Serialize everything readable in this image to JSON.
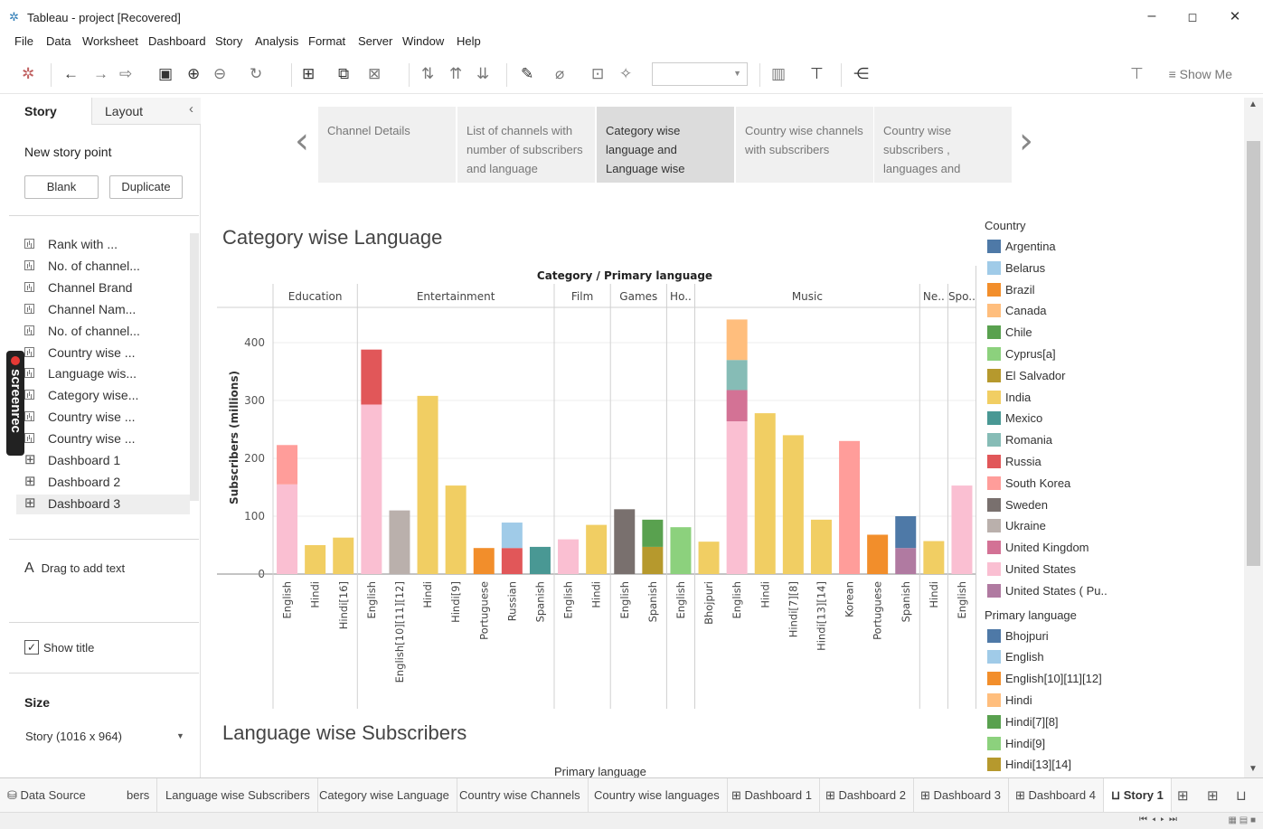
{
  "window": {
    "title": "Tableau - project [Recovered]",
    "minimize": "–",
    "restore": "◻",
    "close": "✕"
  },
  "menu": [
    "File",
    "Data",
    "Worksheet",
    "Dashboard",
    "Story",
    "Analysis",
    "Format",
    "Server",
    "Window",
    "Help"
  ],
  "toolbar": {
    "show_me_label": "Show Me"
  },
  "left_pane": {
    "tab_story": "Story",
    "tab_layout": "Layout",
    "collapse": "‹",
    "new_story_point": "New story point",
    "blank_button": "Blank",
    "duplicate_button": "Duplicate",
    "sheets": [
      {
        "label": "Rank with ...",
        "kind": "worksheet"
      },
      {
        "label": "No. of channel...",
        "kind": "worksheet"
      },
      {
        "label": "Channel Brand",
        "kind": "worksheet"
      },
      {
        "label": "Channel Nam...",
        "kind": "worksheet"
      },
      {
        "label": "No. of channel...",
        "kind": "worksheet"
      },
      {
        "label": "Country wise ...",
        "kind": "worksheet"
      },
      {
        "label": "Language wis...",
        "kind": "worksheet"
      },
      {
        "label": "Category wise...",
        "kind": "worksheet"
      },
      {
        "label": "Country  wise ...",
        "kind": "worksheet"
      },
      {
        "label": "Country wise ...",
        "kind": "worksheet"
      },
      {
        "label": "Dashboard 1",
        "kind": "dashboard"
      },
      {
        "label": "Dashboard 2",
        "kind": "dashboard"
      },
      {
        "label": "Dashboard 3",
        "kind": "dashboard",
        "selected": true
      },
      {
        "label": "Dashboard 4",
        "kind": "dashboard"
      }
    ],
    "drag_text": "Drag to add text",
    "drag_icon": "A",
    "show_title_label": "Show title",
    "show_title_checked": "✓",
    "size_label": "Size",
    "size_value": "Story (1016 x 964)"
  },
  "overlay": {
    "screenrec_label": "screenrec"
  },
  "story": {
    "prev_arrow": "‹",
    "next_arrow": "›",
    "points": [
      {
        "label": "Channel Details"
      },
      {
        "label": "List of channels with number of subscribers and language"
      },
      {
        "label": "Category wise language and Language wise",
        "active": true
      },
      {
        "label": "Country wise channels with subscribers"
      },
      {
        "label": "Country wise subscribers , languages and"
      }
    ],
    "sheet1_title": "Category wise Language",
    "sheet2_title": "Language wise Subscribers",
    "sheet2_header": "Primary language"
  },
  "colors": {
    "Argentina": "#4e79a7",
    "Belarus": "#a0cbe8",
    "Brazil": "#f28e2b",
    "Canada": "#ffbe7d",
    "Chile": "#59a14f",
    "Cyprus[a]": "#8cd17d",
    "El Salvador": "#b6992d",
    "India": "#f1ce63",
    "Mexico": "#499894",
    "Romania": "#86bcb6",
    "Russia": "#e15759",
    "South Korea": "#ff9d9a",
    "Sweden": "#79706e",
    "Ukraine": "#bab0ac",
    "United Kingdom": "#d37295",
    "United States": "#fabfd2",
    "United States ( Pu..": "#b07aa1"
  },
  "legend": {
    "country_title": "Country",
    "country_items": [
      "Argentina",
      "Belarus",
      "Brazil",
      "Canada",
      "Chile",
      "Cyprus[a]",
      "El Salvador",
      "India",
      "Mexico",
      "Romania",
      "Russia",
      "South Korea",
      "Sweden",
      "Ukraine",
      "United Kingdom",
      "United States",
      "United States ( Pu.."
    ],
    "language_title": "Primary language",
    "language_items": [
      {
        "label": "Bhojpuri",
        "color": "#4e79a7"
      },
      {
        "label": "English",
        "color": "#a0cbe8"
      },
      {
        "label": "English[10][11][12]",
        "color": "#f28e2b"
      },
      {
        "label": "Hindi",
        "color": "#ffbe7d"
      },
      {
        "label": "Hindi[7][8]",
        "color": "#59a14f"
      },
      {
        "label": "Hindi[9]",
        "color": "#8cd17d"
      },
      {
        "label": "Hindi[13][14]",
        "color": "#b6992d"
      }
    ]
  },
  "bottom_tabs": {
    "data_source": "Data Source",
    "tabs": [
      "bers",
      "Language wise Subscribers",
      "Category wise Language",
      "Country  wise Channels",
      "Country wise languages",
      "Dashboard 1",
      "Dashboard 2",
      "Dashboard 3",
      "Dashboard 4",
      "Story 1"
    ]
  },
  "chart_data": {
    "type": "bar",
    "stacked": true,
    "title": "Category / Primary language",
    "ylabel": "Subscribers (millions)",
    "ylim": [
      0,
      450
    ],
    "yticks": [
      0,
      100,
      200,
      300,
      400
    ],
    "grid": true,
    "categories": [
      {
        "name": "Education",
        "bars": [
          {
            "label": "English",
            "stack": [
              {
                "country": "United States",
                "value": 155
              },
              {
                "country": "South Korea",
                "value": 68
              }
            ]
          },
          {
            "label": "Hindi",
            "stack": [
              {
                "country": "India",
                "value": 50
              }
            ]
          },
          {
            "label": "Hindi[16]",
            "stack": [
              {
                "country": "India",
                "value": 63
              }
            ]
          }
        ]
      },
      {
        "name": "Entertainment",
        "bars": [
          {
            "label": "English",
            "stack": [
              {
                "country": "United States",
                "value": 293
              },
              {
                "country": "Russia",
                "value": 95
              }
            ]
          },
          {
            "label": "English[10][11][12]",
            "stack": [
              {
                "country": "Ukraine",
                "value": 110
              }
            ]
          },
          {
            "label": "Hindi",
            "stack": [
              {
                "country": "India",
                "value": 308
              }
            ]
          },
          {
            "label": "Hindi[9]",
            "stack": [
              {
                "country": "India",
                "value": 153
              }
            ]
          },
          {
            "label": "Portuguese",
            "stack": [
              {
                "country": "Brazil",
                "value": 45
              }
            ]
          },
          {
            "label": "Russian",
            "stack": [
              {
                "country": "Russia",
                "value": 45
              },
              {
                "country": "Belarus",
                "value": 44
              }
            ]
          },
          {
            "label": "Spanish",
            "stack": [
              {
                "country": "Mexico",
                "value": 47
              }
            ]
          }
        ]
      },
      {
        "name": "Film",
        "bars": [
          {
            "label": "English",
            "stack": [
              {
                "country": "United States",
                "value": 60
              }
            ]
          },
          {
            "label": "Hindi",
            "stack": [
              {
                "country": "India",
                "value": 85
              }
            ]
          }
        ]
      },
      {
        "name": "Games",
        "bars": [
          {
            "label": "English",
            "stack": [
              {
                "country": "Sweden",
                "value": 112
              }
            ]
          },
          {
            "label": "Spanish",
            "stack": [
              {
                "country": "El Salvador",
                "value": 47
              },
              {
                "country": "Chile",
                "value": 47
              }
            ]
          }
        ]
      },
      {
        "name": "Ho..",
        "bars": [
          {
            "label": "English",
            "stack": [
              {
                "country": "Cyprus[a]",
                "value": 81
              }
            ]
          }
        ]
      },
      {
        "name": "Music",
        "bars": [
          {
            "label": "Bhojpuri",
            "stack": [
              {
                "country": "India",
                "value": 56
              }
            ]
          },
          {
            "label": "English",
            "stack": [
              {
                "country": "United States",
                "value": 264
              },
              {
                "country": "United Kingdom",
                "value": 54
              },
              {
                "country": "Romania",
                "value": 52
              },
              {
                "country": "Canada",
                "value": 70
              }
            ]
          },
          {
            "label": "Hindi",
            "stack": [
              {
                "country": "India",
                "value": 278
              }
            ]
          },
          {
            "label": "Hindi[7][8]",
            "stack": [
              {
                "country": "India",
                "value": 240
              }
            ]
          },
          {
            "label": "Hindi[13][14]",
            "stack": [
              {
                "country": "India",
                "value": 94
              }
            ]
          },
          {
            "label": "Korean",
            "stack": [
              {
                "country": "South Korea",
                "value": 230
              }
            ]
          },
          {
            "label": "Portuguese",
            "stack": [
              {
                "country": "Brazil",
                "value": 68
              }
            ]
          },
          {
            "label": "Spanish",
            "stack": [
              {
                "country": "United States ( Pu..",
                "value": 45
              },
              {
                "country": "Argentina",
                "value": 55
              }
            ]
          }
        ]
      },
      {
        "name": "Ne..",
        "bars": [
          {
            "label": "Hindi",
            "stack": [
              {
                "country": "India",
                "value": 57
              }
            ]
          }
        ]
      },
      {
        "name": "Spo..",
        "bars": [
          {
            "label": "English",
            "stack": [
              {
                "country": "United States",
                "value": 153
              }
            ]
          }
        ]
      }
    ]
  }
}
